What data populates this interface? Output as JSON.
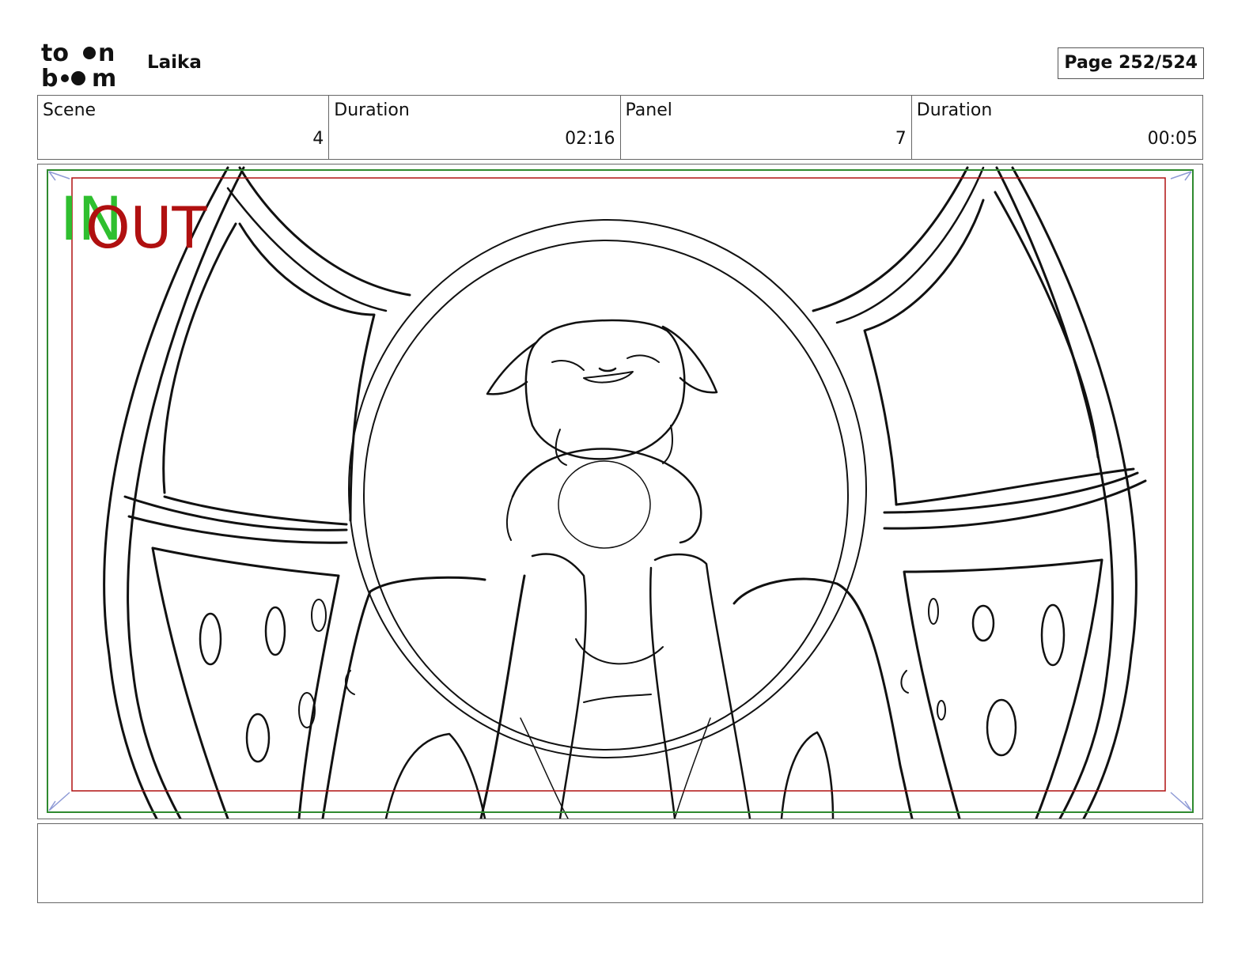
{
  "header": {
    "logo_top": "to",
    "logo_top2": "n",
    "logo_bottom": "b",
    "logo_bottom2": "m",
    "project_title": "Laika",
    "page_label": "Page 252/524"
  },
  "info": {
    "scene_label": "Scene",
    "scene_value": "4",
    "scene_duration_label": "Duration",
    "scene_duration_value": "02:16",
    "panel_label": "Panel",
    "panel_value": "7",
    "panel_duration_label": "Duration",
    "panel_duration_value": "00:05"
  },
  "frame": {
    "in_label": "IN",
    "out_label": "OUT",
    "in_color": "#2fbf2f",
    "out_color": "#b01010"
  },
  "notes": {
    "text": ""
  }
}
